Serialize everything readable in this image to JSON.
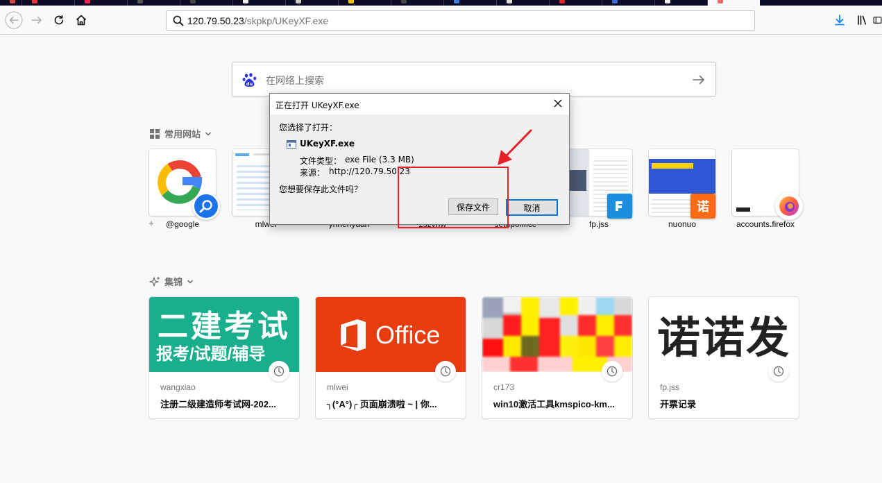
{
  "toolbar": {
    "url_host": "120.79.50.23",
    "url_path": "/skpkp/UKeyXF.exe"
  },
  "search": {
    "placeholder": "在网络上搜索"
  },
  "top_sites": {
    "heading": "常用网站",
    "sites": [
      {
        "label": "@google"
      },
      {
        "label": "mlwei"
      },
      {
        "label": "yhnehydan"
      },
      {
        "label": "1szvnw"
      },
      {
        "label": "setupofffice"
      },
      {
        "label": "fp.jss"
      },
      {
        "label": "nuonuo"
      },
      {
        "label": "accounts.firefox"
      }
    ]
  },
  "highlights": {
    "heading": "集锦",
    "cards": [
      {
        "host": "wangxiao",
        "title": "注册二级建造师考试网-202...",
        "img_line1": "二建考试",
        "img_line2": "报考/试题/辅导",
        "color": "#1aaf8c"
      },
      {
        "host": "mlwei",
        "title": "╮(°A°)╭ 页面崩溃啦 ~ | 你...",
        "img_text": "Office",
        "color": "#e83b0e"
      },
      {
        "host": "cr173",
        "title": "win10激活工具kmspico-km..."
      },
      {
        "host": "fp.jss",
        "title": "开票记录",
        "img_text": "诺诺发"
      }
    ]
  },
  "dialog": {
    "title": "正在打开 UKeyXF.exe",
    "intro": "您选择了打开：",
    "filename": "UKeyXF.exe",
    "type_label": "文件类型：",
    "type_value": "exe File (3.3 MB)",
    "source_label": "来源：",
    "source_value": "http://120.79.50.23",
    "question": "您想要保存此文件吗？",
    "save_button": "保存文件",
    "cancel_button": "取消"
  }
}
